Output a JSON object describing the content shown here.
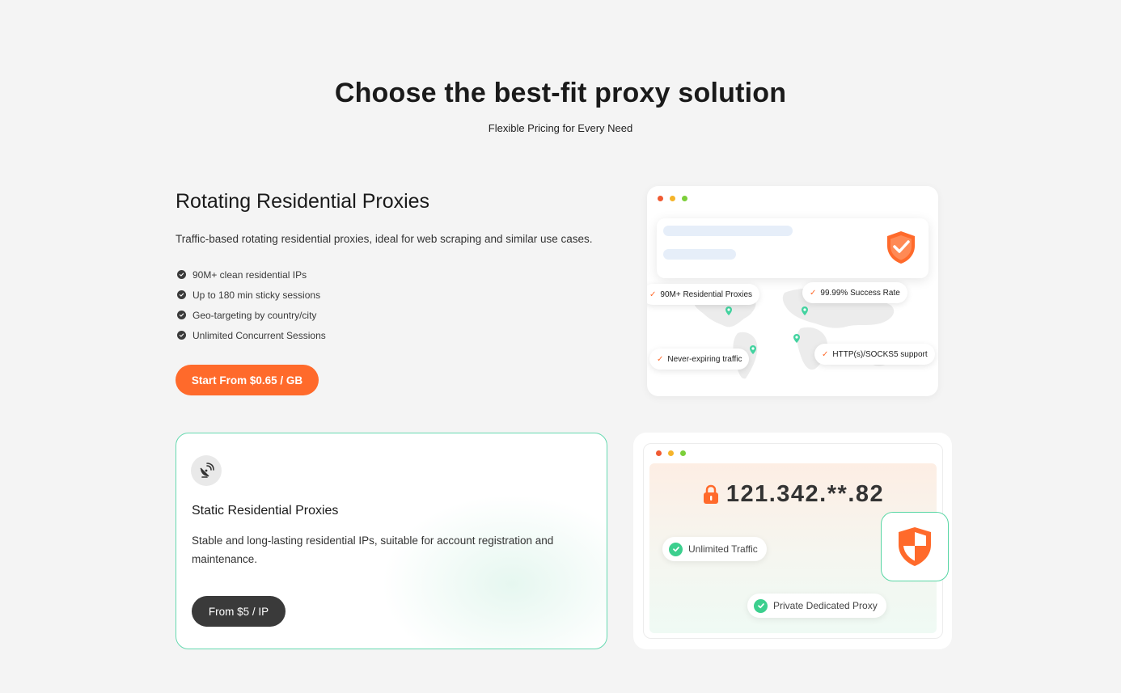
{
  "hero": {
    "title": "Choose the best-fit proxy solution",
    "subtitle": "Flexible Pricing for Every Need"
  },
  "rotating": {
    "title": "Rotating Residential Proxies",
    "description": "Traffic-based rotating residential proxies, ideal for web scraping and similar use cases.",
    "features": [
      "90M+ clean residential IPs",
      "Up to 180 min sticky sessions",
      "Geo-targeting by country/city",
      "Unlimited Concurrent Sessions"
    ],
    "cta_label": "Start From $0.65 / GB",
    "illustration": {
      "pills": [
        "90M+ Residential Proxies",
        "99.99% Success Rate",
        "Never-expiring traffic",
        "HTTP(s)/SOCKS5 support"
      ]
    }
  },
  "static": {
    "title": "Static Residential Proxies",
    "description": "Stable and long-lasting residential IPs, suitable for account registration and maintenance.",
    "cta_label": "From $5 / IP",
    "illustration": {
      "ip": "121.342.**.82",
      "pills": [
        "Unlimited Traffic",
        "Private Dedicated Proxy"
      ]
    }
  },
  "colors": {
    "accent": "#ff6a2b",
    "dark_button": "#3a3a3a",
    "success": "#3ccf8e",
    "card_border": "#66d9b0"
  },
  "icons": [
    "check-circle-icon",
    "shield-check-icon",
    "world-map",
    "location-pin-icon",
    "satellite-dish-icon",
    "lock-icon",
    "shield-icon",
    "green-check-icon"
  ]
}
